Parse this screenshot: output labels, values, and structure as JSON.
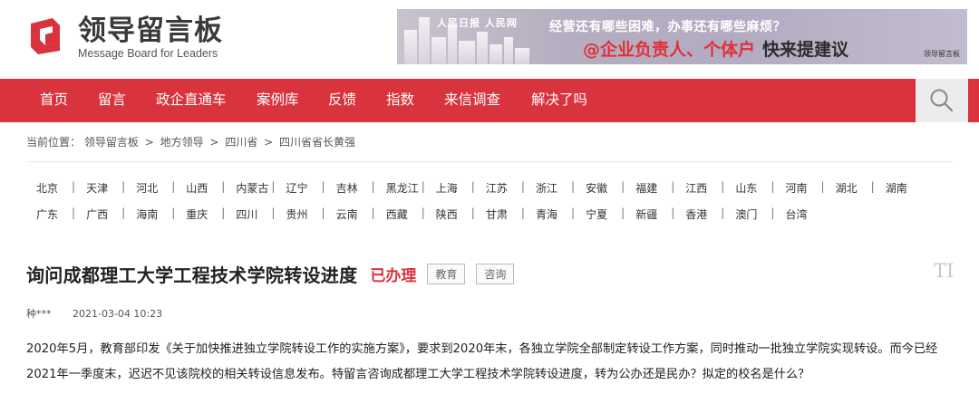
{
  "header": {
    "logo_cn": "领导留言板",
    "logo_en": "Message Board for Leaders",
    "banner": {
      "brand": "人民日报 人民网",
      "line1": "经营还有哪些困难，办事还有哪些麻烦？",
      "line2_highlight": "@企业负责人、个体户",
      "line2_action": "快来提建议",
      "small": "领导留言板"
    }
  },
  "nav": {
    "items": [
      "首页",
      "留言",
      "政企直通车",
      "案例库",
      "反馈",
      "指数",
      "来信调查",
      "解决了吗"
    ],
    "search_icon": "search-icon"
  },
  "breadcrumb": {
    "label": "当前位置：",
    "items": [
      "领导留言板",
      "地方领导",
      "四川省",
      "四川省省长黄强"
    ],
    "separator": ">"
  },
  "regions": {
    "row1": [
      "北京",
      "天津",
      "河北",
      "山西",
      "内蒙古",
      "辽宁",
      "吉林",
      "黑龙江",
      "上海",
      "江苏",
      "浙江",
      "安徽",
      "福建",
      "江西",
      "山东",
      "河南",
      "湖北",
      "湖南"
    ],
    "row2": [
      "广东",
      "广西",
      "海南",
      "重庆",
      "四川",
      "贵州",
      "云南",
      "西藏",
      "陕西",
      "甘肃",
      "青海",
      "宁夏",
      "新疆",
      "香港",
      "澳门",
      "台湾"
    ],
    "separator": "|"
  },
  "article": {
    "title": "询问成都理工大学工程技术学院转设进度",
    "status": "已办理",
    "tags": [
      "教育",
      "咨询"
    ],
    "font_toggle": "TI",
    "author": "种***",
    "date": "2021-03-04 10:23",
    "body": "2020年5月，教育部印发《关于加快推进独立学院转设工作的实施方案》，要求到2020年末，各独立学院全部制定转设工作方案，同时推动一批独立学院实现转设。而今已经2021年一季度末，迟迟不见该院校的相关转设信息发布。特留言咨询成都理工大学工程技术学院转设进度，转为公办还是民办？拟定的校名是什么？"
  },
  "colors": {
    "brand_red": "#d9333d",
    "status_red": "#d9333d"
  }
}
